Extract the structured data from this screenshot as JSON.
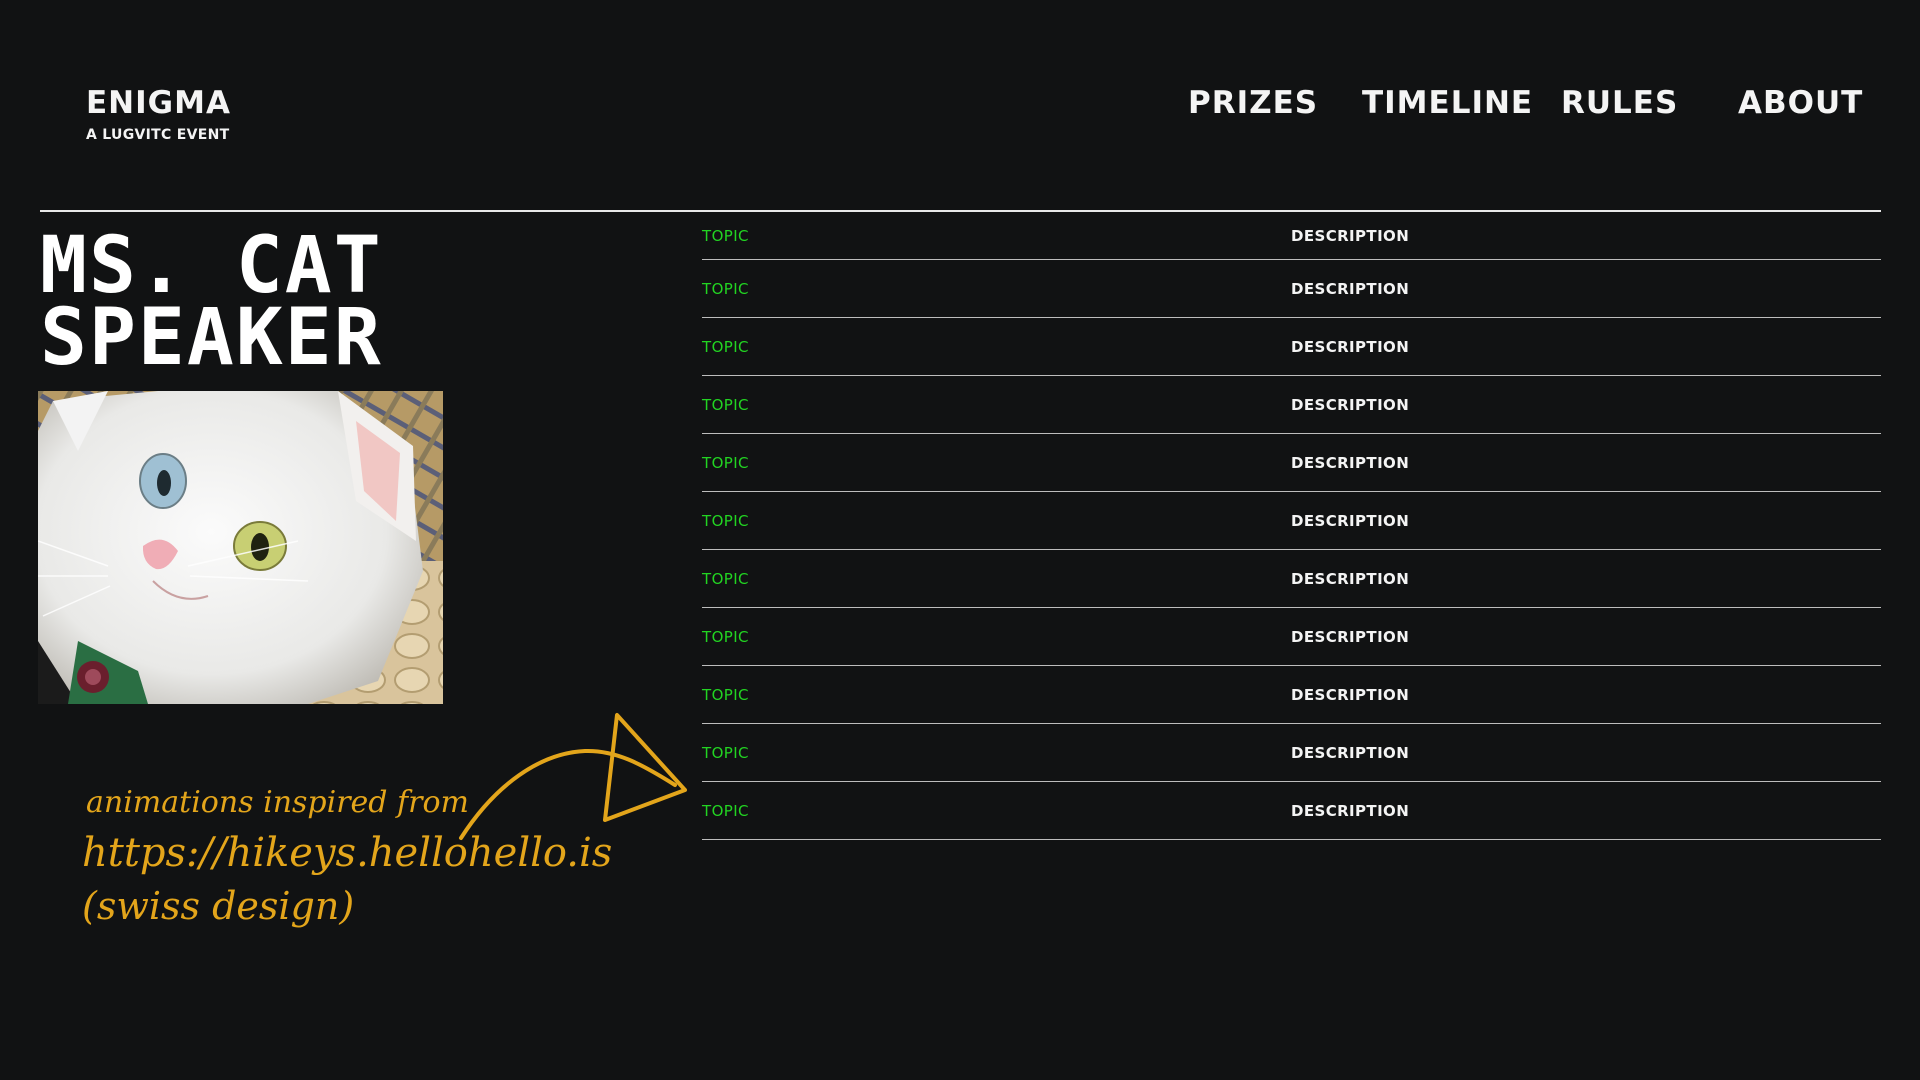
{
  "brand": {
    "title": "ENIGMA",
    "subtitle": "A LUGVITC EVENT"
  },
  "nav": {
    "prizes": "PRIZES",
    "timeline": "TIMELINE",
    "rules": "RULES",
    "about": "ABOUT"
  },
  "speaker": {
    "line1": "MS. CAT",
    "line2": "SPEAKER",
    "photo_subject": "white cat with odd-colored eyes"
  },
  "topics": {
    "rows": [
      {
        "topic": "TOPIC",
        "description": "DESCRIPTION"
      },
      {
        "topic": "TOPIC",
        "description": "DESCRIPTION"
      },
      {
        "topic": "TOPIC",
        "description": "DESCRIPTION"
      },
      {
        "topic": "TOPIC",
        "description": "DESCRIPTION"
      },
      {
        "topic": "TOPIC",
        "description": "DESCRIPTION"
      },
      {
        "topic": "TOPIC",
        "description": "DESCRIPTION"
      },
      {
        "topic": "TOPIC",
        "description": "DESCRIPTION"
      },
      {
        "topic": "TOPIC",
        "description": "DESCRIPTION"
      },
      {
        "topic": "TOPIC",
        "description": "DESCRIPTION"
      },
      {
        "topic": "TOPIC",
        "description": "DESCRIPTION"
      },
      {
        "topic": "TOPIC",
        "description": "DESCRIPTION"
      }
    ]
  },
  "note": {
    "line1": "animations inspired from",
    "line2": "https://hikeys.hellohello.is",
    "line3": "(swiss design)"
  },
  "colors": {
    "background": "#111213",
    "text": "#f4f4f4",
    "topic": "#22d422",
    "accent": "#e3a51b"
  },
  "icons": {
    "arrow": "hand-drawn-arrow-icon"
  }
}
